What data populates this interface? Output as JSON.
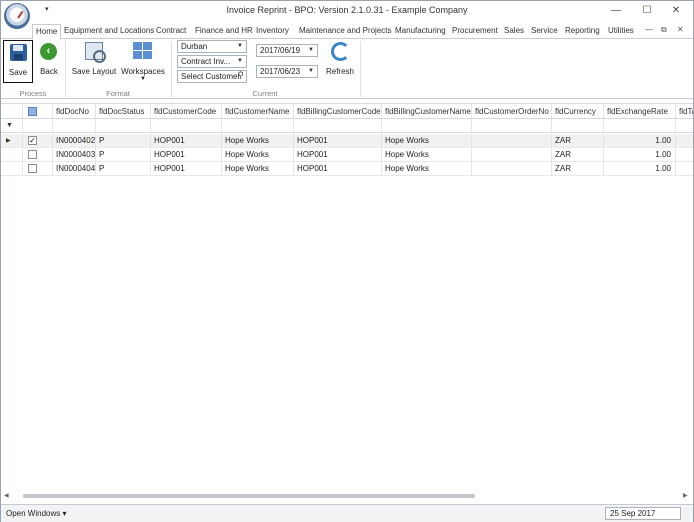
{
  "window": {
    "title": "Invoice Reprint - BPO: Version 2.1.0.31 - Example Company",
    "minimize_glyph": "—",
    "maximize_glyph": "☐",
    "close_glyph": "✕",
    "qat_glyph": "▾"
  },
  "tabs": [
    "Home",
    "Equipment and Locations",
    "Contract",
    "Finance and HR",
    "Inventory",
    "Maintenance and Projects",
    "Manufacturing",
    "Procurement",
    "Sales",
    "Service",
    "Reporting",
    "Utilities"
  ],
  "tab_controls": {
    "minimize": "—",
    "restore": "⧉",
    "close": "✕"
  },
  "ribbon": {
    "save_label": "Save",
    "back_label": "Back",
    "save_layout_label": "Save Layout",
    "workspaces_label": "Workspaces",
    "refresh_label": "Refresh",
    "site_value": "Durban",
    "doc_type_value": "Contract Inv...",
    "customer_placeholder": "Select Customer",
    "date_from": "2017/06/19",
    "date_to": "2017/06/23",
    "groups": {
      "process": "Process",
      "format": "Format",
      "current": "Current"
    }
  },
  "grid": {
    "columns": [
      "fldDocNo",
      "fldDocStatus",
      "fldCustomerCode",
      "fldCustomerName",
      "fldBillingCustomerCode",
      "fldBillingCustomerName",
      "fldCustomerOrderNo",
      "fldCurrency",
      "fldExchangeRate",
      "fldTa"
    ],
    "rows": [
      {
        "checked": true,
        "selected": true,
        "cells": [
          "IN0000402",
          "P",
          "HOP001",
          "Hope Works",
          "HOP001",
          "Hope Works",
          "",
          "ZAR",
          "1.00",
          ""
        ]
      },
      {
        "checked": false,
        "selected": false,
        "cells": [
          "IN0000403",
          "P",
          "HOP001",
          "Hope Works",
          "HOP001",
          "Hope Works",
          "",
          "ZAR",
          "1.00",
          ""
        ]
      },
      {
        "checked": false,
        "selected": false,
        "cells": [
          "IN0000404",
          "P",
          "HOP001",
          "Hope Works",
          "HOP001",
          "Hope Works",
          "",
          "ZAR",
          "1.00",
          ""
        ]
      }
    ]
  },
  "statusbar": {
    "open_windows_label": "Open Windows ▾",
    "date": "25 Sep 2017"
  }
}
